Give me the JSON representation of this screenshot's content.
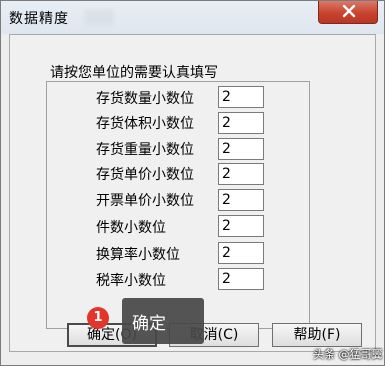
{
  "window": {
    "title": "数据精度"
  },
  "dialog": {
    "instruction": "请按您单位的需要认真填写",
    "fields": [
      {
        "label": "存货数量小数位",
        "value": "2"
      },
      {
        "label": "存货体积小数位",
        "value": "2"
      },
      {
        "label": "存货重量小数位",
        "value": "2"
      },
      {
        "label": "存货单价小数位",
        "value": "2"
      },
      {
        "label": "开票单价小数位",
        "value": "2"
      },
      {
        "label": "件数小数位",
        "value": "2"
      },
      {
        "label": "换算率小数位",
        "value": "2"
      },
      {
        "label": "税率小数位",
        "value": "2"
      }
    ],
    "buttons": {
      "ok": "确定(O)",
      "cancel": "取消(C)",
      "help": "帮助(F)"
    }
  },
  "tooltip": {
    "step": "1",
    "text": "确定"
  },
  "watermark": {
    "text": "头条 @猛哥翼"
  },
  "colors": {
    "close_button": "#c94330",
    "badge": "#e4352c",
    "tooltip_bg": "#464646"
  },
  "icons": {
    "close": "close-icon"
  }
}
